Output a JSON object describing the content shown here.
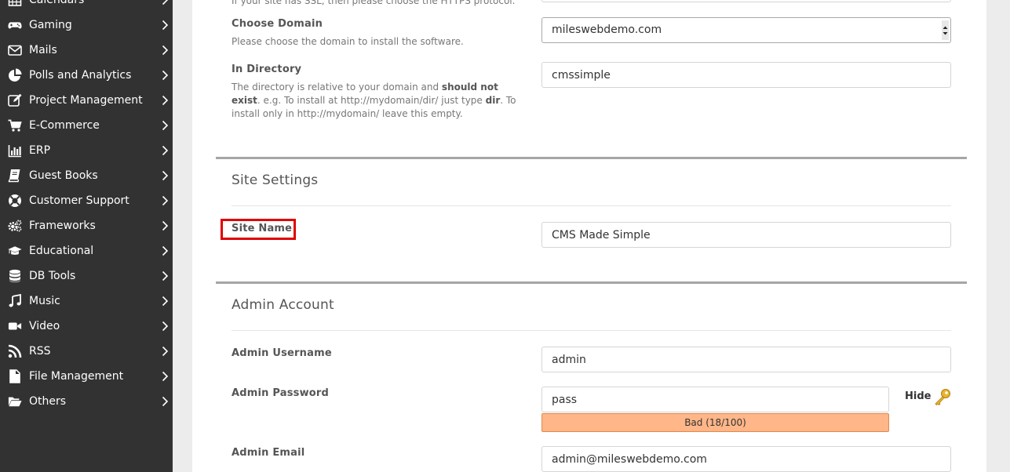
{
  "sidebar": {
    "items": [
      {
        "label": "Calendars",
        "icon": "calendar-icon"
      },
      {
        "label": "Gaming",
        "icon": "gamepad-icon"
      },
      {
        "label": "Mails",
        "icon": "envelope-icon"
      },
      {
        "label": "Polls and Analytics",
        "icon": "pie-chart-icon"
      },
      {
        "label": "Project Management",
        "icon": "edit-icon"
      },
      {
        "label": "E-Commerce",
        "icon": "cart-icon"
      },
      {
        "label": "ERP",
        "icon": "bar-chart-icon"
      },
      {
        "label": "Guest Books",
        "icon": "book-icon"
      },
      {
        "label": "Customer Support",
        "icon": "lifebuoy-icon"
      },
      {
        "label": "Frameworks",
        "icon": "gears-icon"
      },
      {
        "label": "Educational",
        "icon": "graduation-cap-icon"
      },
      {
        "label": "DB Tools",
        "icon": "database-icon"
      },
      {
        "label": "Music",
        "icon": "music-icon"
      },
      {
        "label": "Video",
        "icon": "video-camera-icon"
      },
      {
        "label": "RSS",
        "icon": "rss-icon"
      },
      {
        "label": "File Management",
        "icon": "file-icon"
      },
      {
        "label": "Others",
        "icon": "folder-open-icon"
      }
    ]
  },
  "install": {
    "protocol_help": "If your site has SSL, then please choose the HTTPS protocol.",
    "domain": {
      "label": "Choose Domain",
      "help": "Please choose the domain to install the software.",
      "value": "mileswebdemo.com"
    },
    "directory": {
      "label": "In Directory",
      "help_1": "The directory is relative to your domain and ",
      "help_bold_1": "should not exist",
      "help_2": ". e.g. To install at http://mydomain/dir/ just type ",
      "help_bold_2": "dir",
      "help_3": ". To install only in http://mydomain/ leave this empty.",
      "value": "cmssimple"
    }
  },
  "site_settings": {
    "title": "Site Settings",
    "site_name_label": "Site Name",
    "site_name_value": "CMS Made Simple"
  },
  "admin_account": {
    "title": "Admin Account",
    "username_label": "Admin Username",
    "username_value": "admin",
    "password_label": "Admin Password",
    "password_value": "pass",
    "hide_label": "Hide",
    "strength_text": "Bad (18/100)",
    "email_label": "Admin Email",
    "email_value": "admin@mileswebdemo.com"
  },
  "colors": {
    "sidebar_bg": "#323232",
    "highlight": "#e00000",
    "strength_bad": "#ffb688"
  }
}
